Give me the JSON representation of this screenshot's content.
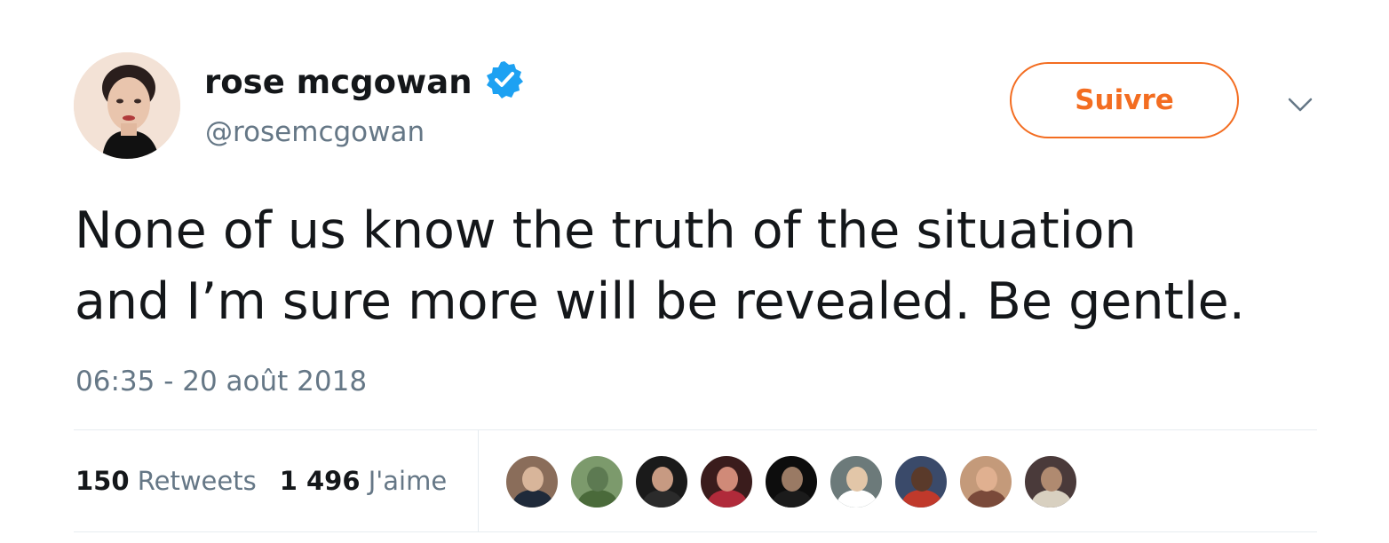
{
  "user": {
    "display_name": "rose mcgowan",
    "handle": "@rosemcgowan",
    "verified": true
  },
  "follow_button": {
    "label": "Suivre"
  },
  "tweet": {
    "text_lines": [
      "None of us know the truth of the situation",
      "and I’m sure more will be revealed. Be gentle."
    ],
    "timestamp": "06:35 - 20 août 2018"
  },
  "stats": {
    "retweets_count": "150",
    "retweets_label": "Retweets",
    "likes_count": "1 496",
    "likes_label": "J'aime"
  },
  "colors": {
    "accent": "#f36d21",
    "verified": "#1da1f2",
    "text": "#14171a",
    "secondary": "#657786",
    "divider": "#e6ecf0"
  },
  "icons": {
    "verified": "verified-badge-icon",
    "caret": "chevron-down-icon"
  },
  "likers": [
    {
      "name": "liker-1",
      "bg": "#8a6d5a",
      "face": "#d8b59a",
      "body": "#1f2a3a"
    },
    {
      "name": "liker-2",
      "bg": "#7c9a6c",
      "face": "#5d7a52",
      "body": "#4a6a3a"
    },
    {
      "name": "liker-3",
      "bg": "#1a1a1a",
      "face": "#c79a82",
      "body": "#2b2b2b"
    },
    {
      "name": "liker-4",
      "bg": "#3a1c1c",
      "face": "#d08a78",
      "body": "#b02a3a"
    },
    {
      "name": "liker-5",
      "bg": "#0d0d0d",
      "face": "#9a7a64",
      "body": "#1b1b1b"
    },
    {
      "name": "liker-6",
      "bg": "#6c7a7a",
      "face": "#e2c6a8",
      "body": "#ffffff"
    },
    {
      "name": "liker-7",
      "bg": "#3a4a6a",
      "face": "#5a3a2a",
      "body": "#c0392b"
    },
    {
      "name": "liker-8",
      "bg": "#c49a7a",
      "face": "#e0b090",
      "body": "#7a4a3a"
    },
    {
      "name": "liker-9",
      "bg": "#4a3a3a",
      "face": "#b08a70",
      "body": "#d8d0c0"
    }
  ]
}
